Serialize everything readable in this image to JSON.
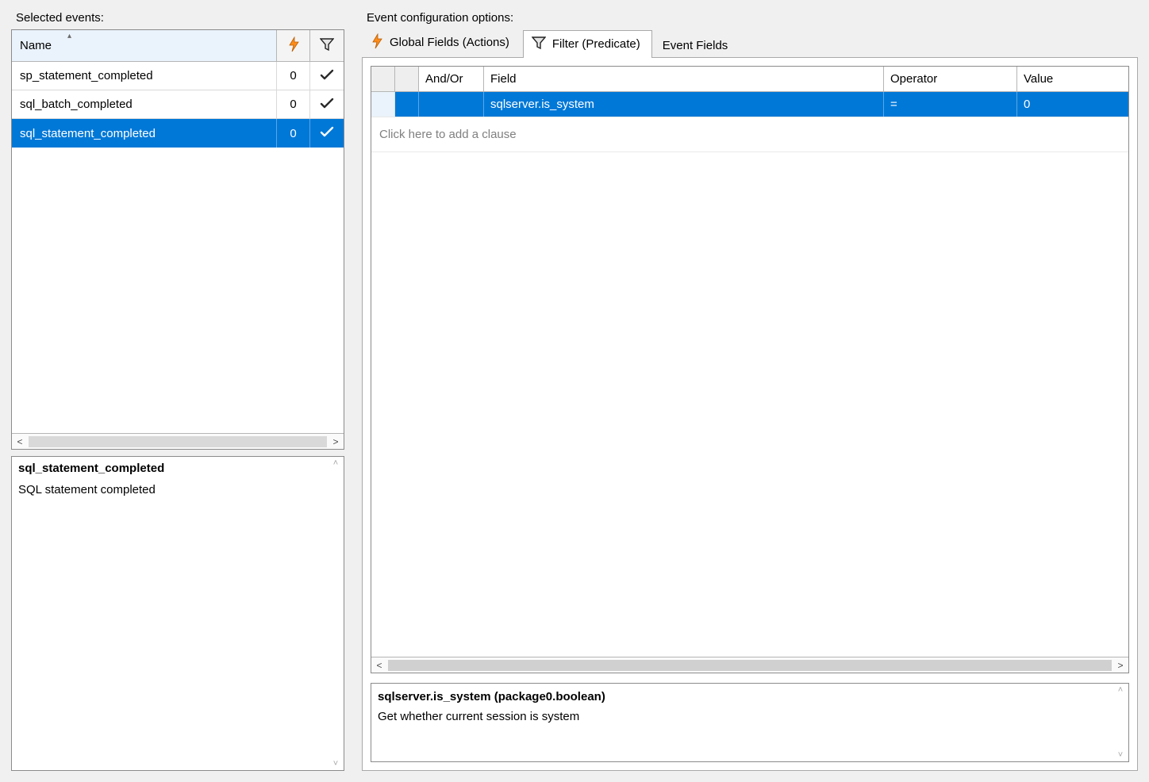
{
  "labels": {
    "selected_events": "Selected events:",
    "config_options": "Event configuration options:"
  },
  "events_grid": {
    "columns": {
      "name": "Name"
    },
    "rows": [
      {
        "name": "sp_statement_completed",
        "bolt": "0",
        "filtered": true,
        "selected": false
      },
      {
        "name": "sql_batch_completed",
        "bolt": "0",
        "filtered": true,
        "selected": false
      },
      {
        "name": "sql_statement_completed",
        "bolt": "0",
        "filtered": true,
        "selected": true
      }
    ]
  },
  "event_desc": {
    "title": "sql_statement_completed",
    "body": "SQL statement completed"
  },
  "tabs": {
    "global": "Global Fields (Actions)",
    "filter": "Filter (Predicate)",
    "eventfields": "Event Fields"
  },
  "predicate": {
    "columns": {
      "andor": "And/Or",
      "field": "Field",
      "operator": "Operator",
      "value": "Value"
    },
    "rows": [
      {
        "andor": "",
        "field": "sqlserver.is_system",
        "operator": "=",
        "value": "0",
        "selected": true
      }
    ],
    "add_hint": "Click here to add a clause"
  },
  "predicate_info": {
    "title": "sqlserver.is_system (package0.boolean)",
    "body": "Get whether current session is system"
  }
}
